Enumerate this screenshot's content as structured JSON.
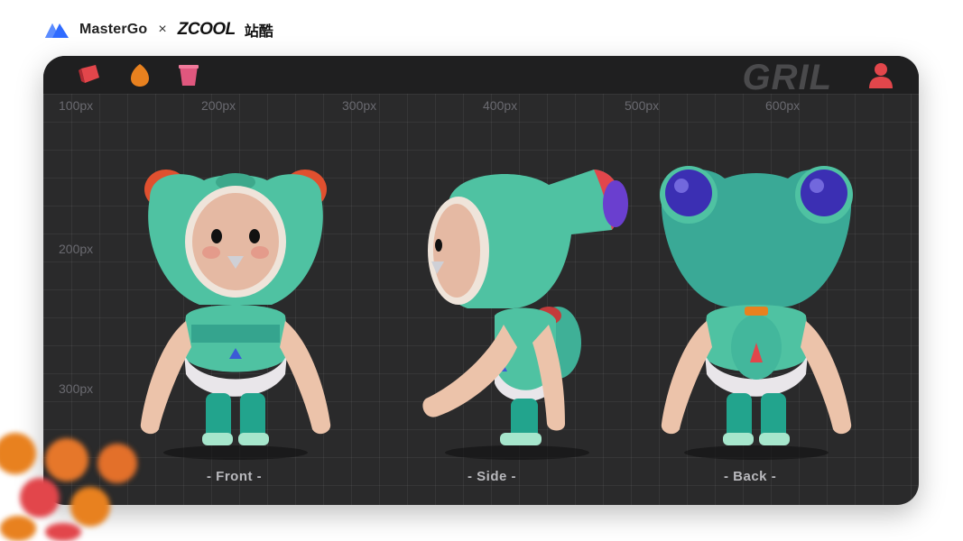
{
  "header": {
    "mastergo_label": "MasterGo",
    "separator": "×",
    "zcool_label": "ZCOOL",
    "zcool_cn_label": "站酷"
  },
  "card": {
    "title": "GRIL",
    "rulers": {
      "x": [
        "100px",
        "200px",
        "300px",
        "400px",
        "500px",
        "600px"
      ],
      "y": [
        "200px",
        "300px"
      ]
    },
    "views": [
      {
        "label": "- Front -"
      },
      {
        "label": "- Side -"
      },
      {
        "label": "- Back -"
      }
    ]
  },
  "colors": {
    "card_bg": "#2a2a2b",
    "body_teal": "#4fc2a2",
    "accent_red": "#e2464b",
    "accent_orange": "#e8811f",
    "accent_pink": "#e0577e",
    "eye_purple": "#3b2fb3"
  },
  "icons": [
    "eraser-icon",
    "drop-icon",
    "cup-icon",
    "user-icon",
    "mastergo-logo-icon"
  ]
}
